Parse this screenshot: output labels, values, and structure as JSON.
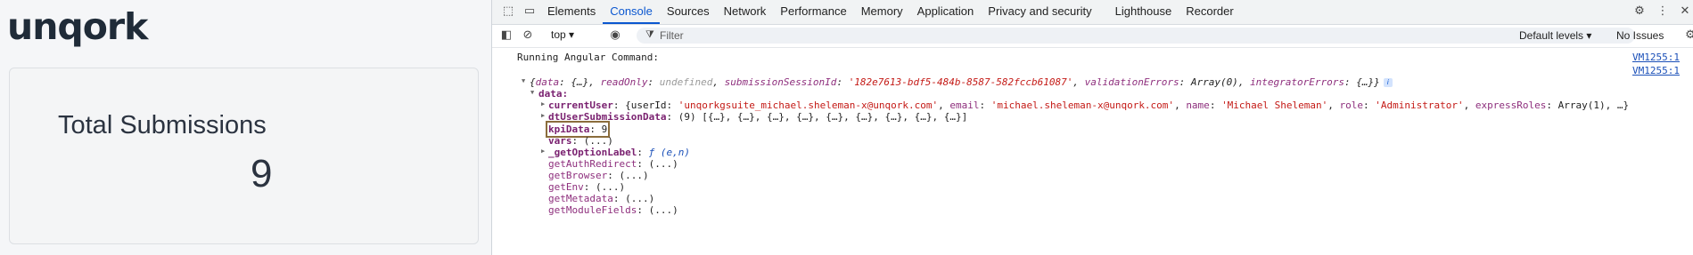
{
  "app": {
    "logo": "unqork",
    "kpi": {
      "title": "Total Submissions",
      "value": "9"
    }
  },
  "devtools": {
    "tabs": [
      "Elements",
      "Console",
      "Sources",
      "Network",
      "Performance",
      "Memory",
      "Application",
      "Privacy and security",
      "Lighthouse",
      "Recorder"
    ],
    "active_tab": "Console",
    "toolbar": {
      "context": "top",
      "filter_placeholder": "Filter",
      "levels": "Default levels",
      "issues": "No Issues"
    },
    "console": {
      "message": "Running Angular Command:",
      "source": "VM1255:1",
      "object_summary": {
        "open": "{",
        "data_key": "data",
        "data_val": "{…}",
        "readonly_key": "readOnly",
        "readonly_val": "undefined",
        "session_key": "submissionSessionId",
        "session_val": "'182e7613-bdf5-484b-8587-582fccb61087'",
        "validation_key": "validationErrors",
        "validation_val": "Array(0)",
        "integrator_key": "integratorErrors",
        "integrator_val": "{…}",
        "close": "}"
      },
      "data_label": "data:",
      "current_user": {
        "key": "currentUser",
        "prefix": "{userId: ",
        "userId": "'unqorkgsuite_michael.sheleman-x@unqork.com'",
        "email_key": "email",
        "email": "'michael.sheleman-x@unqork.com'",
        "name_key": "name",
        "name": "'Michael Sheleman'",
        "role_key": "role",
        "role": "'Administrator'",
        "express_key": "expressRoles",
        "express_val": "Array(1)",
        "tail": ", …}"
      },
      "dt_user": {
        "key": "dtUserSubmissionData",
        "val": "(9) [{…}, {…}, {…}, {…}, {…}, {…}, {…}, {…}, {…}]"
      },
      "kpi_data": {
        "key": "kpiData",
        "val": "9"
      },
      "vars": {
        "key": "vars",
        "val": "(...)"
      },
      "option_label": {
        "key": "_getOptionLabel",
        "val": "ƒ (e,n)"
      },
      "getters": [
        {
          "key": "getAuthRedirect",
          "val": "(...)"
        },
        {
          "key": "getBrowser",
          "val": "(...)"
        },
        {
          "key": "getEnv",
          "val": "(...)"
        },
        {
          "key": "getMetadata",
          "val": "(...)"
        },
        {
          "key": "getModuleFields",
          "val": "(...)"
        }
      ]
    }
  }
}
